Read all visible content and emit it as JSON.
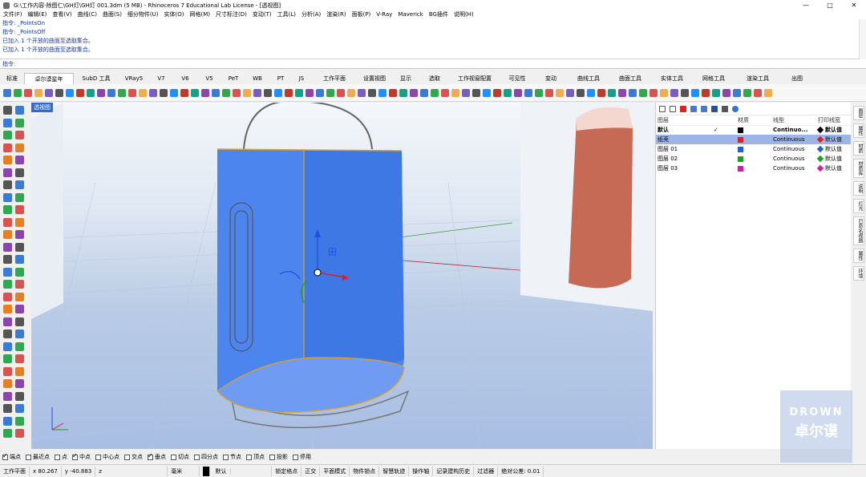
{
  "window": {
    "title": "G:\\工作内容-除图仁\\GH灯\\GH灯 001.3dm (5 MB) - Rhinoceros 7 Educational Lab License - [透视图]",
    "min": "—",
    "max": "□",
    "close": "✕"
  },
  "menu": [
    "文件(F)",
    "编辑(E)",
    "查看(V)",
    "曲线(C)",
    "曲面(S)",
    "细分物件(U)",
    "实体(O)",
    "网格(M)",
    "尺寸标注(D)",
    "变动(T)",
    "工具(L)",
    "分析(A)",
    "渲染(R)",
    "面板(P)",
    "V-Ray",
    "Maverick",
    "BG插件",
    "说明(H)"
  ],
  "command_history": [
    "指令: _PointsOn",
    "指令: _PointsOff",
    "已加入 1 个开放的曲面至选取集合。",
    "已加入 1 个开放的曲面至选取集合。"
  ],
  "command_prompt": "指令:",
  "tabs": [
    "标准",
    "卓尔谟星年",
    "SubD 工具",
    "VRay5",
    "V7",
    "V6",
    "V5",
    "PeT",
    "WB",
    "PT",
    "JS",
    "工作平面",
    "设置视图",
    "显示",
    "选取",
    "工作视窗配置",
    "可见性",
    "变动",
    "曲线工具",
    "曲面工具",
    "实体工具",
    "网格工具",
    "渲染工具",
    "出图"
  ],
  "active_tab_index": 1,
  "viewport": {
    "label": "透视图",
    "gumball_label": "田"
  },
  "layers": {
    "headers": [
      "图层",
      "",
      "材质",
      "线型",
      "打印线宽"
    ],
    "rows": [
      {
        "name": "默认",
        "current": "✓",
        "color": "#000000",
        "linetype": "Continuo...",
        "printwidth": "默认值",
        "pw_color": "#000000",
        "bold": true,
        "selected": false
      },
      {
        "name": "纸壳",
        "current": "",
        "color": "#e02020",
        "linetype": "Continuous",
        "printwidth": "默认值",
        "pw_color": "#e02020",
        "bold": false,
        "selected": true
      },
      {
        "name": "图层 01",
        "current": "",
        "color": "#2060e0",
        "linetype": "Continuous",
        "printwidth": "默认值",
        "pw_color": "#2060e0",
        "bold": false,
        "selected": false
      },
      {
        "name": "图层 02",
        "current": "",
        "color": "#20a020",
        "linetype": "Continuous",
        "printwidth": "默认值",
        "pw_color": "#20a020",
        "bold": false,
        "selected": false
      },
      {
        "name": "图层 03",
        "current": "",
        "color": "#d020a0",
        "linetype": "Continuous",
        "printwidth": "默认值",
        "pw_color": "#d020a0",
        "bold": false,
        "selected": false
      }
    ]
  },
  "side_tabs": [
    "图层",
    "属性",
    "材质",
    "材质库",
    "说明",
    "灯光",
    "已命名视图",
    "属性",
    "环境"
  ],
  "osnaps": [
    {
      "label": "端点",
      "on": true
    },
    {
      "label": "最近点",
      "on": false
    },
    {
      "label": "点",
      "on": false
    },
    {
      "label": "中点",
      "on": true
    },
    {
      "label": "中心点",
      "on": false
    },
    {
      "label": "交点",
      "on": false
    },
    {
      "label": "垂点",
      "on": true
    },
    {
      "label": "切点",
      "on": false
    },
    {
      "label": "四分点",
      "on": false
    },
    {
      "label": "节点",
      "on": false
    },
    {
      "label": "顶点",
      "on": false
    },
    {
      "label": "投影",
      "on": false
    },
    {
      "label": "停用",
      "on": false
    }
  ],
  "status": {
    "cplane": "工作平面",
    "x": "x 80.267",
    "y": "y -40.883",
    "z": "z",
    "units": "毫米",
    "layer": "默认",
    "items": [
      "锁定格点",
      "正交",
      "平面模式",
      "物件锁点",
      "智慧轨迹",
      "操作轴",
      "记录建构历史",
      "过滤器"
    ],
    "tolerance": "绝对公差: 0.01"
  },
  "watermark": {
    "line1": "DROWN",
    "line2": "卓尔谟"
  }
}
